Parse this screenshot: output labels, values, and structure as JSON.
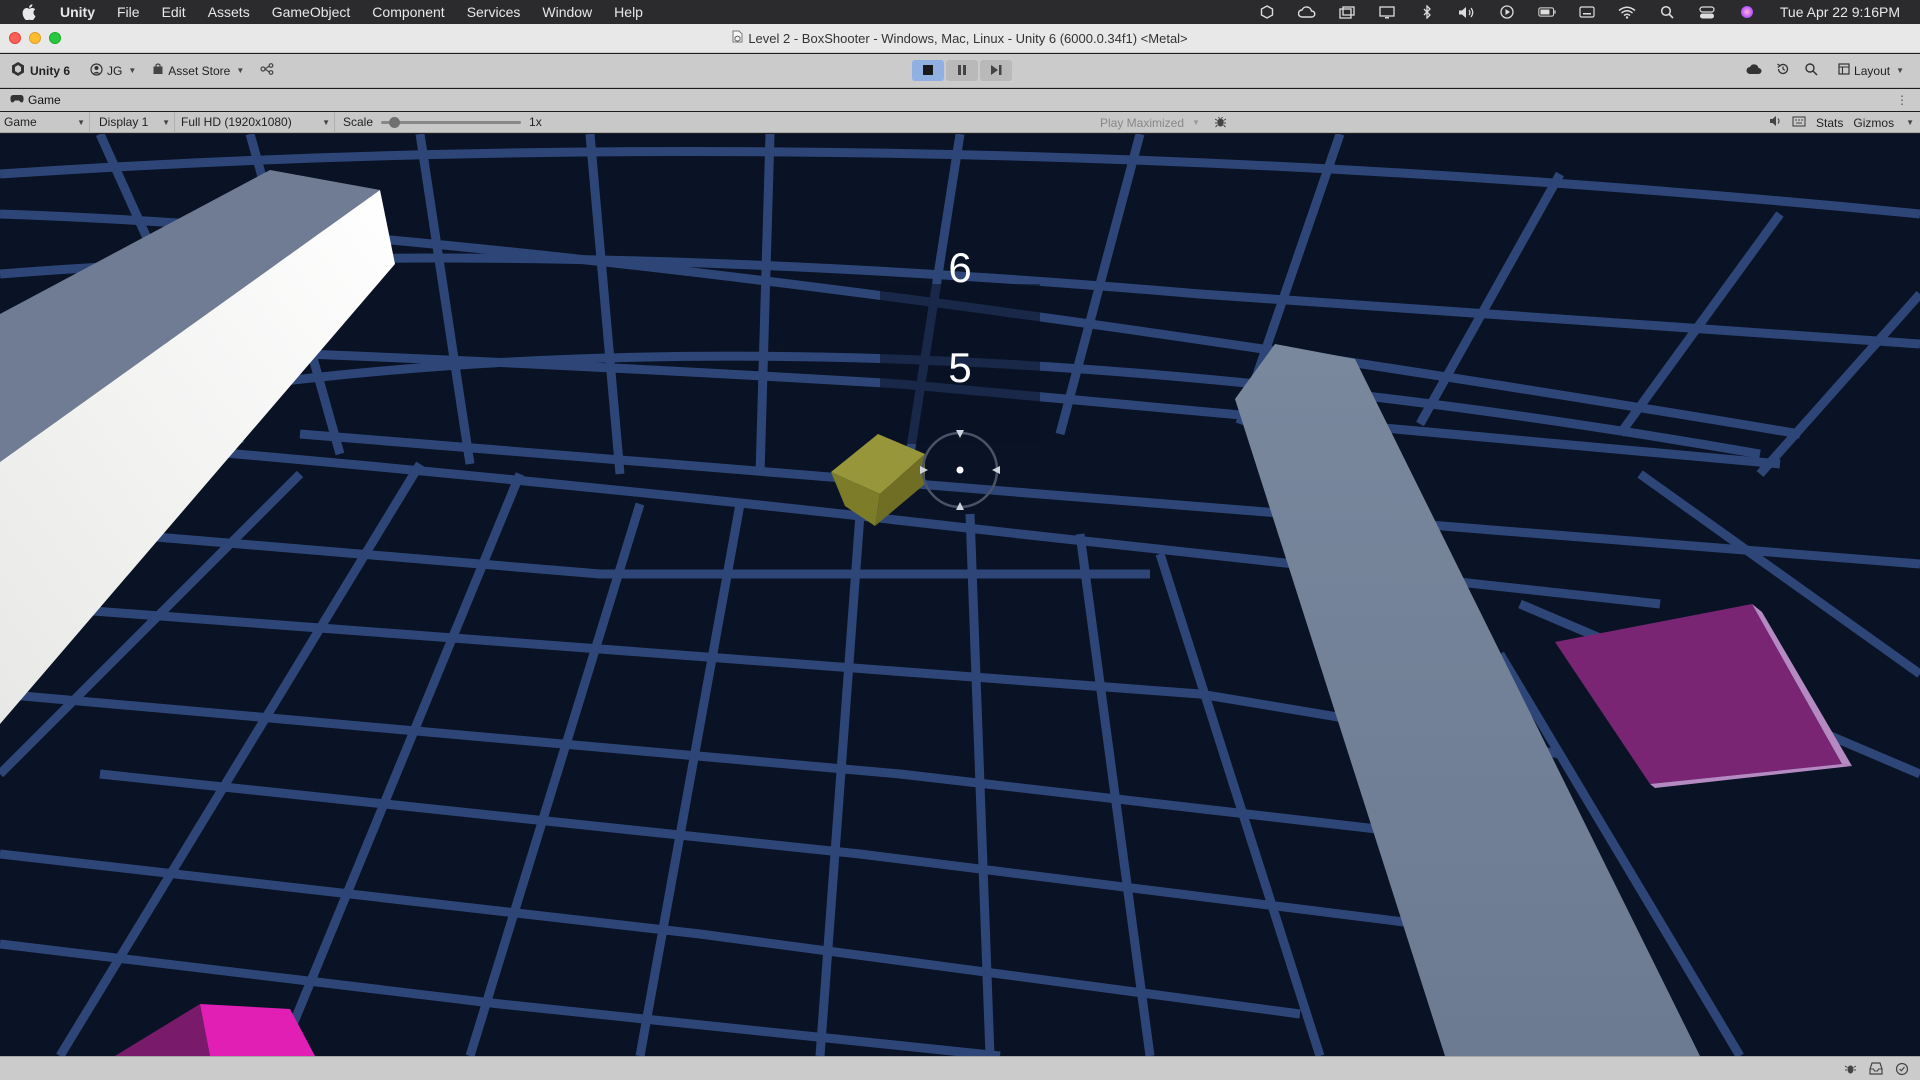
{
  "menubar": {
    "app_name": "Unity",
    "items": [
      "File",
      "Edit",
      "Assets",
      "GameObject",
      "Component",
      "Services",
      "Window",
      "Help"
    ],
    "clock": "Tue Apr 22  9:16PM",
    "status_icons": [
      "unity-hub-icon",
      "creative-cloud-icon",
      "window-stack-icon",
      "display-icon",
      "bluetooth-icon",
      "volume-icon",
      "play-icon",
      "battery-icon",
      "keyboard-icon",
      "wifi-icon",
      "spotlight-search-icon",
      "control-center-icon",
      "siri-icon"
    ]
  },
  "window": {
    "title": "Level 2 - BoxShooter - Windows, Mac, Linux - Unity 6 (6000.0.34f1) <Metal>"
  },
  "toolbar": {
    "unity_label": "Unity 6",
    "account_label": "JG",
    "asset_store_label": "Asset Store",
    "layout_label": "Layout"
  },
  "tab": {
    "label": "Game"
  },
  "gamebar": {
    "view_mode": "Game",
    "display": "Display 1",
    "resolution": "Full HD (1920x1080)",
    "scale_label": "Scale",
    "scale_value": "1x",
    "play_mode": "Play Maximized",
    "stats_label": "Stats",
    "gizmos_label": "Gizmos"
  },
  "game": {
    "hud_top": "6",
    "hud_bottom": "5"
  },
  "colors": {
    "background": "#0a1226",
    "grid": "#2e4a7e",
    "yellow_cube": "#8a8a2c",
    "magenta": "#8a2a7a",
    "pillar": "#7a8aa2"
  }
}
